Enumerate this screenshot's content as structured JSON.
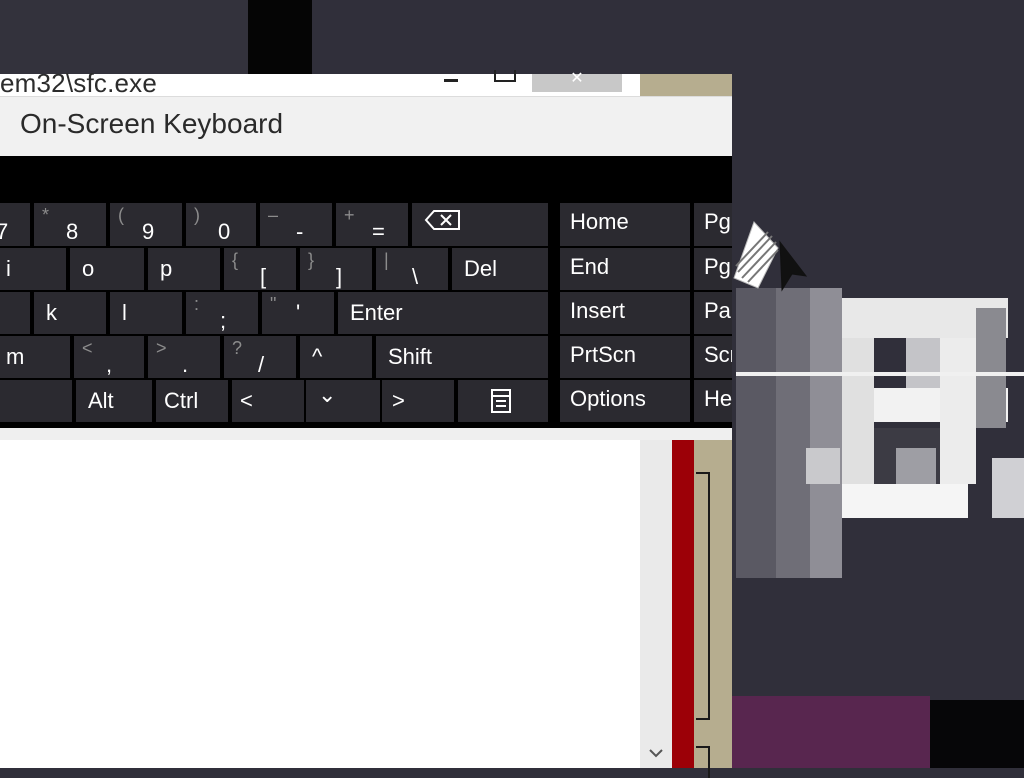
{
  "console_window": {
    "title": "em32\\sfc.exe",
    "close_label": "✕"
  },
  "osk": {
    "title": "On-Screen Keyboard",
    "rows": [
      [
        {
          "shift": "",
          "main": "7"
        },
        {
          "shift": "*",
          "main": "8"
        },
        {
          "shift": "(",
          "main": "9"
        },
        {
          "shift": ")",
          "main": "0"
        },
        {
          "shift": "–",
          "main": "-"
        },
        {
          "shift": "+",
          "main": "="
        }
      ],
      [
        {
          "label": "i"
        },
        {
          "label": "o"
        },
        {
          "label": "p"
        },
        {
          "shift": "{",
          "main": "["
        },
        {
          "shift": "}",
          "main": "]"
        },
        {
          "shift": "|",
          "main": "\\"
        },
        {
          "label": "Del"
        }
      ],
      [
        {
          "label": "k"
        },
        {
          "label": "l"
        },
        {
          "shift": ":",
          "main": ";"
        },
        {
          "shift": "\"",
          "main": "'"
        },
        {
          "label": "Enter"
        }
      ],
      [
        {
          "label": "m"
        },
        {
          "shift": "<",
          "main": ","
        },
        {
          "shift": ">",
          "main": "."
        },
        {
          "shift": "?",
          "main": "/"
        },
        {
          "label": "^"
        },
        {
          "label": "Shift"
        }
      ],
      [
        {
          "label": "Alt"
        },
        {
          "label": "Ctrl"
        },
        {
          "label": "<"
        },
        {
          "label": "⌄"
        },
        {
          "label": ">"
        }
      ]
    ],
    "nav_keys": [
      "Home",
      "End",
      "Insert",
      "PrtScn",
      "Options"
    ],
    "edge_keys": [
      "Pg",
      "Pg",
      "Pa",
      "Scr",
      "He"
    ]
  },
  "colors": {
    "key_bg": "#2b2a30",
    "osk_bg": "#000000",
    "desktop": "#302f3a",
    "console_accent_red": "#9c0007",
    "console_accent_tan": "#b6ad8f"
  },
  "icons": [
    "backspace-icon",
    "menu-icon",
    "chevron-down-icon",
    "mouse-cursor-icon"
  ]
}
